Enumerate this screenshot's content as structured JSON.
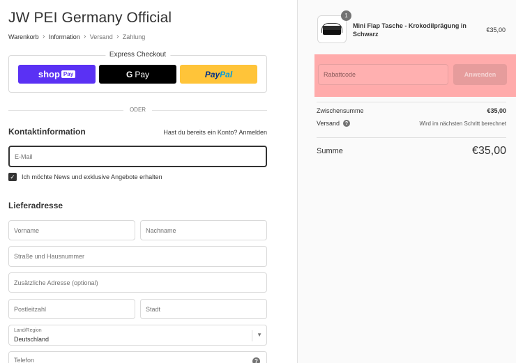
{
  "store": {
    "title": "JW PEI Germany Official"
  },
  "breadcrumb": [
    {
      "label": "Warenkorb",
      "state": "link"
    },
    {
      "label": "Information",
      "state": "active"
    },
    {
      "label": "Versand",
      "state": "muted"
    },
    {
      "label": "Zahlung",
      "state": "muted"
    }
  ],
  "express": {
    "label": "Express Checkout",
    "shop_pay": {
      "shop": "shop",
      "pay": "Pay"
    },
    "google_pay": {
      "g": "G",
      "pay": "Pay"
    },
    "paypal": {
      "pay": "Pay",
      "pal": "Pal"
    }
  },
  "divider": {
    "label": "ODER"
  },
  "contact": {
    "title": "Kontaktinformation",
    "account_prompt": "Hast du bereits ein Konto?",
    "login_link": "Anmelden",
    "email_placeholder": "E-Mail",
    "newsletter_label": "Ich möchte News und exklusive Angebote erhalten",
    "newsletter_checked": true
  },
  "shipping_address": {
    "title": "Lieferadresse",
    "first_name_placeholder": "Vorname",
    "last_name_placeholder": "Nachname",
    "street_placeholder": "Straße und Hausnummer",
    "address2_placeholder": "Zusätzliche Adresse (optional)",
    "zip_placeholder": "Postleitzahl",
    "city_placeholder": "Stadt",
    "country_label": "Land/Region",
    "country_value": "Deutschland",
    "phone_placeholder": "Telefon"
  },
  "order": {
    "item": {
      "name": "Mini Flap Tasche - Krokodilprägung in Schwarz",
      "quantity": "1",
      "price": "€35,00"
    },
    "discount": {
      "placeholder": "Rabattcode",
      "apply_label": "Anwenden"
    },
    "subtotal_label": "Zwischensumme",
    "subtotal_value": "€35,00",
    "shipping_label": "Versand",
    "shipping_value": "Wird im nächsten Schritt berechnet",
    "total_label": "Summe",
    "total_value": "€35,00"
  },
  "colors": {
    "shop_pay": "#5a31f4",
    "paypal": "#ffc439",
    "google_pay": "#000000",
    "discount_highlight": "#ffabab"
  }
}
